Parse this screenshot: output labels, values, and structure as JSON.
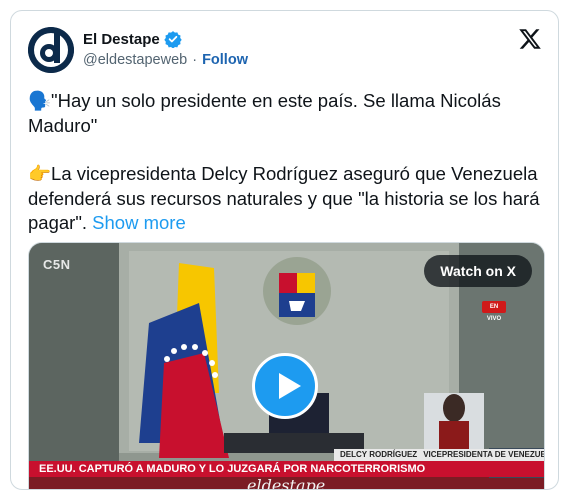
{
  "author": {
    "name": "El Destape",
    "handle": "@eldestapeweb",
    "separator": "·",
    "follow_label": "Follow",
    "avatar_letter": "d"
  },
  "tweet": {
    "line1_emoji": "🗣️",
    "line1": "\"Hay un solo presidente en este país. Se llama Nicolás Maduro\"",
    "line2_emoji": "👉",
    "line2": "La vicepresidenta Delcy Rodríguez aseguró que Venezuela defenderá sus recursos naturales y que \"la historia se los hará pagar\". ",
    "show_more": "Show more"
  },
  "video": {
    "channel": "C5N",
    "watch_label": "Watch on X",
    "live_label": "EN VIVO",
    "caption_name": "DELCY RODRÍGUEZ",
    "caption_role": "VICEPRESIDENTA DE VENEZUELA",
    "headline": "EE.UU. CAPTURÓ A MADURO Y LO JUZGARÁ POR NARCOTERRORISMO",
    "watermark": "eldestape"
  },
  "colors": {
    "accent": "#1d9bf0",
    "follow": "#1d64b0",
    "headline_bar": "#c8102e"
  },
  "icons": [
    "verified-badge-icon",
    "x-logo-icon",
    "play-icon"
  ]
}
